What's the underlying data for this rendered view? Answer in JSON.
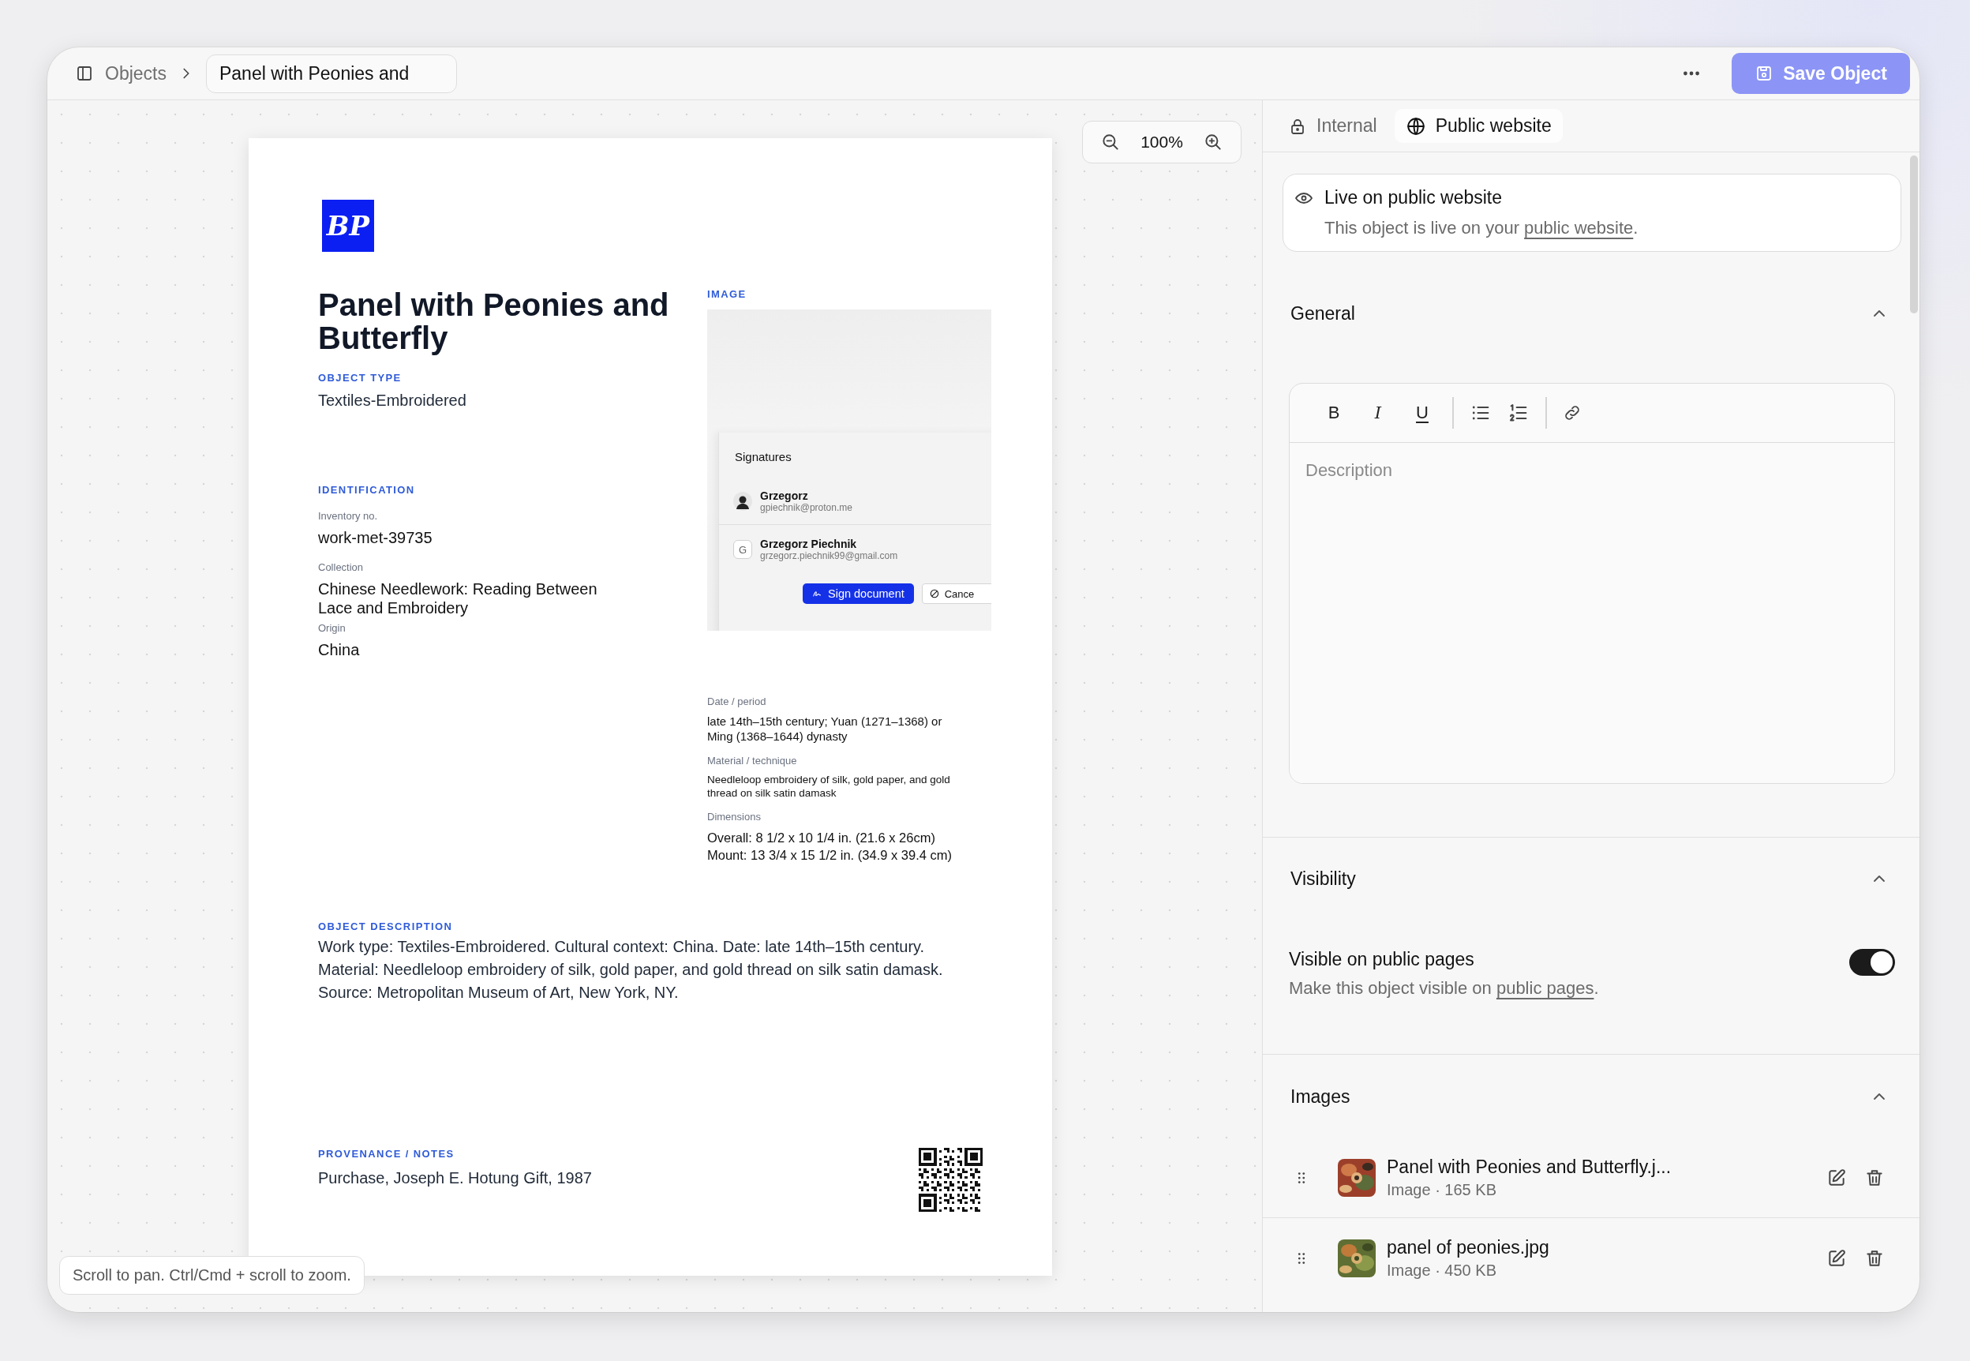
{
  "topbar": {
    "root_crumb": "Objects",
    "current_crumb": "Panel with Peonies and",
    "save_label": "Save Object"
  },
  "canvas": {
    "zoom": "100%",
    "hint": "Scroll to pan. Ctrl/Cmd + scroll to zoom."
  },
  "document": {
    "logo": "BP",
    "title": "Panel with Peonies and Butterfly",
    "object_type": {
      "label": "OBJECT TYPE",
      "value": "Textiles-Embroidered"
    },
    "identification": {
      "heading": "IDENTIFICATION",
      "fields": [
        {
          "label": "Inventory no.",
          "value": "work-met-39735"
        },
        {
          "label": "Collection",
          "value": "Chinese Needlework: Reading Between Lace and Embroidery"
        },
        {
          "label": "Origin",
          "value": "China"
        }
      ]
    },
    "image": {
      "heading": "IMAGE",
      "signatures": {
        "title": "Signatures",
        "signers": [
          {
            "name": "Grzegorz",
            "email": "gpiechnik@proton.me"
          },
          {
            "kind": "initial",
            "initial": "G",
            "name": "Grzegorz Piechnik",
            "email": "grzegorz.piechnik99@gmail.com"
          }
        ],
        "sign_button": "Sign document",
        "cancel_button": "Cance"
      }
    },
    "details": [
      {
        "label": "Date / period",
        "value": "late 14th–15th century; Yuan (1271–1368) or Ming (1368–1644) dynasty"
      },
      {
        "label": "Material / technique",
        "value": "Needleloop embroidery of silk, gold paper, and gold thread on silk satin damask"
      },
      {
        "label": "Dimensions",
        "value": "Overall: 8 1/2 x 10 1/4 in. (21.6 x 26cm)\nMount: 13 3/4 x 15 1/2 in. (34.9 x 39.4 cm)"
      }
    ],
    "description": {
      "heading": "OBJECT DESCRIPTION",
      "text": "Work type: Textiles-Embroidered. Cultural context: China. Date: late 14th–15th century.\nMaterial: Needleloop embroidery of silk, gold paper, and gold thread on silk satin damask.\nSource: Metropolitan Museum of Art, New York, NY."
    },
    "provenance": {
      "heading": "PROVENANCE / NOTES",
      "text": "Purchase, Joseph E. Hotung Gift, 1987"
    }
  },
  "panel": {
    "tabs": [
      {
        "label": "Internal",
        "selected": false
      },
      {
        "label": "Public website",
        "selected": true
      }
    ],
    "live_card": {
      "title": "Live on public website",
      "text": "This object is live on your ",
      "link": "public website",
      "after": "."
    },
    "general": {
      "title": "General",
      "expanded": true,
      "toolbar": [
        {
          "kind": "bold",
          "glyph": "B"
        },
        {
          "kind": "italic",
          "glyph": "I"
        },
        {
          "kind": "underline",
          "glyph": "U"
        },
        {
          "kind": "separator"
        },
        {
          "kind": "bullet-list"
        },
        {
          "kind": "numbered-list"
        },
        {
          "kind": "separator"
        },
        {
          "kind": "link"
        }
      ],
      "placeholder": "Description"
    },
    "visibility": {
      "title": "Visibility",
      "expanded": true,
      "setting": {
        "title": "Visible on public pages",
        "text": "Make this object visible on ",
        "link": "public pages",
        "after": ".",
        "on": true
      }
    },
    "images": {
      "title": "Images",
      "expanded": true,
      "items": [
        {
          "name": "Panel with Peonies and Butterfly.j...",
          "meta": "Image · 165 KB"
        },
        {
          "name": "panel of peonies.jpg",
          "meta": "Image · 450 KB"
        }
      ]
    }
  }
}
